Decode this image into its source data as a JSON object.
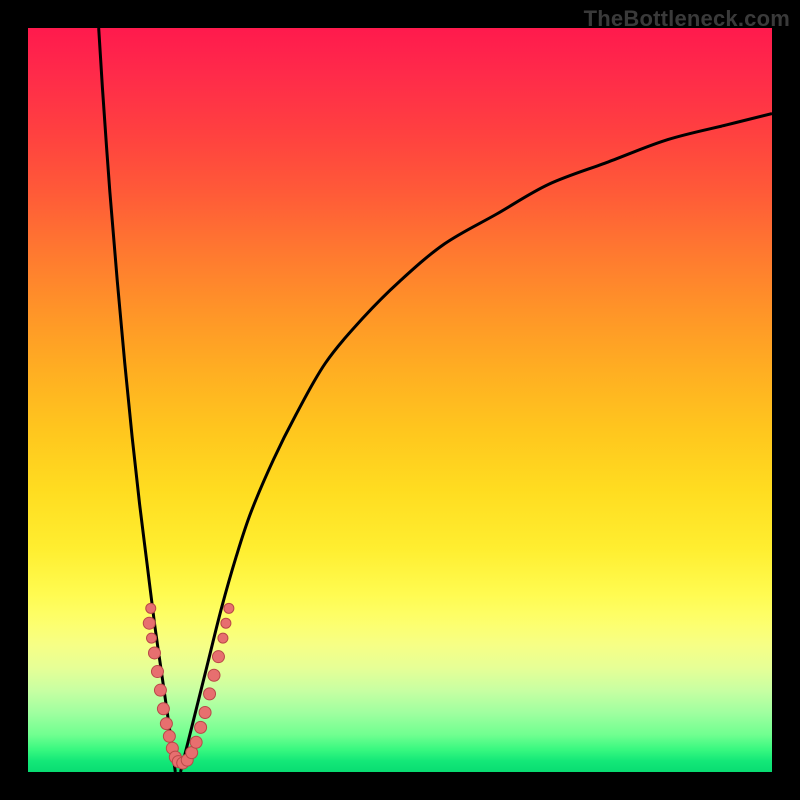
{
  "watermark": "TheBottleneck.com",
  "colors": {
    "frame": "#000000",
    "curve": "#000000",
    "dot_fill": "#e76f6f",
    "dot_stroke": "#b94848"
  },
  "chart_data": {
    "type": "line",
    "title": "",
    "xlabel": "",
    "ylabel": "",
    "xlim": [
      0,
      100
    ],
    "ylim": [
      0,
      100
    ],
    "grid": false,
    "legend": false,
    "series": [
      {
        "name": "left-branch",
        "x": [
          9.5,
          10,
          11,
          12,
          13,
          14,
          15,
          16,
          17,
          18,
          19,
          19.8
        ],
        "y": [
          100,
          92,
          78,
          66,
          55,
          45,
          36,
          28,
          20,
          13,
          6,
          0
        ]
      },
      {
        "name": "right-branch",
        "x": [
          20.5,
          22,
          24,
          26,
          28,
          30,
          33,
          36,
          40,
          45,
          50,
          56,
          63,
          70,
          78,
          86,
          94,
          100
        ],
        "y": [
          0,
          6,
          14,
          22,
          29,
          35,
          42,
          48,
          55,
          61,
          66,
          71,
          75,
          79,
          82,
          85,
          87,
          88.5
        ]
      }
    ],
    "scatter": {
      "name": "highlight-dots",
      "points": [
        {
          "x": 16.5,
          "y": 22,
          "r": 5
        },
        {
          "x": 16.3,
          "y": 20,
          "r": 6
        },
        {
          "x": 16.6,
          "y": 18,
          "r": 5
        },
        {
          "x": 17.0,
          "y": 16,
          "r": 6
        },
        {
          "x": 17.4,
          "y": 13.5,
          "r": 6
        },
        {
          "x": 17.8,
          "y": 11,
          "r": 6
        },
        {
          "x": 18.2,
          "y": 8.5,
          "r": 6
        },
        {
          "x": 18.6,
          "y": 6.5,
          "r": 6
        },
        {
          "x": 19.0,
          "y": 4.8,
          "r": 6
        },
        {
          "x": 19.4,
          "y": 3.2,
          "r": 6
        },
        {
          "x": 19.8,
          "y": 2.0,
          "r": 6
        },
        {
          "x": 20.2,
          "y": 1.4,
          "r": 6
        },
        {
          "x": 20.8,
          "y": 1.2,
          "r": 6
        },
        {
          "x": 21.4,
          "y": 1.6,
          "r": 6
        },
        {
          "x": 22.0,
          "y": 2.6,
          "r": 6
        },
        {
          "x": 22.6,
          "y": 4.0,
          "r": 6
        },
        {
          "x": 23.2,
          "y": 6.0,
          "r": 6
        },
        {
          "x": 23.8,
          "y": 8.0,
          "r": 6
        },
        {
          "x": 24.4,
          "y": 10.5,
          "r": 6
        },
        {
          "x": 25.0,
          "y": 13.0,
          "r": 6
        },
        {
          "x": 25.6,
          "y": 15.5,
          "r": 6
        },
        {
          "x": 26.2,
          "y": 18.0,
          "r": 5
        },
        {
          "x": 26.6,
          "y": 20.0,
          "r": 5
        },
        {
          "x": 27.0,
          "y": 22.0,
          "r": 5
        }
      ]
    },
    "gradient_stops": [
      {
        "pos": 0,
        "color": "#ff1a4d"
      },
      {
        "pos": 30,
        "color": "#ff7830"
      },
      {
        "pos": 60,
        "color": "#ffdc1e"
      },
      {
        "pos": 82,
        "color": "#f6ff86"
      },
      {
        "pos": 100,
        "color": "#08dc72"
      }
    ]
  }
}
